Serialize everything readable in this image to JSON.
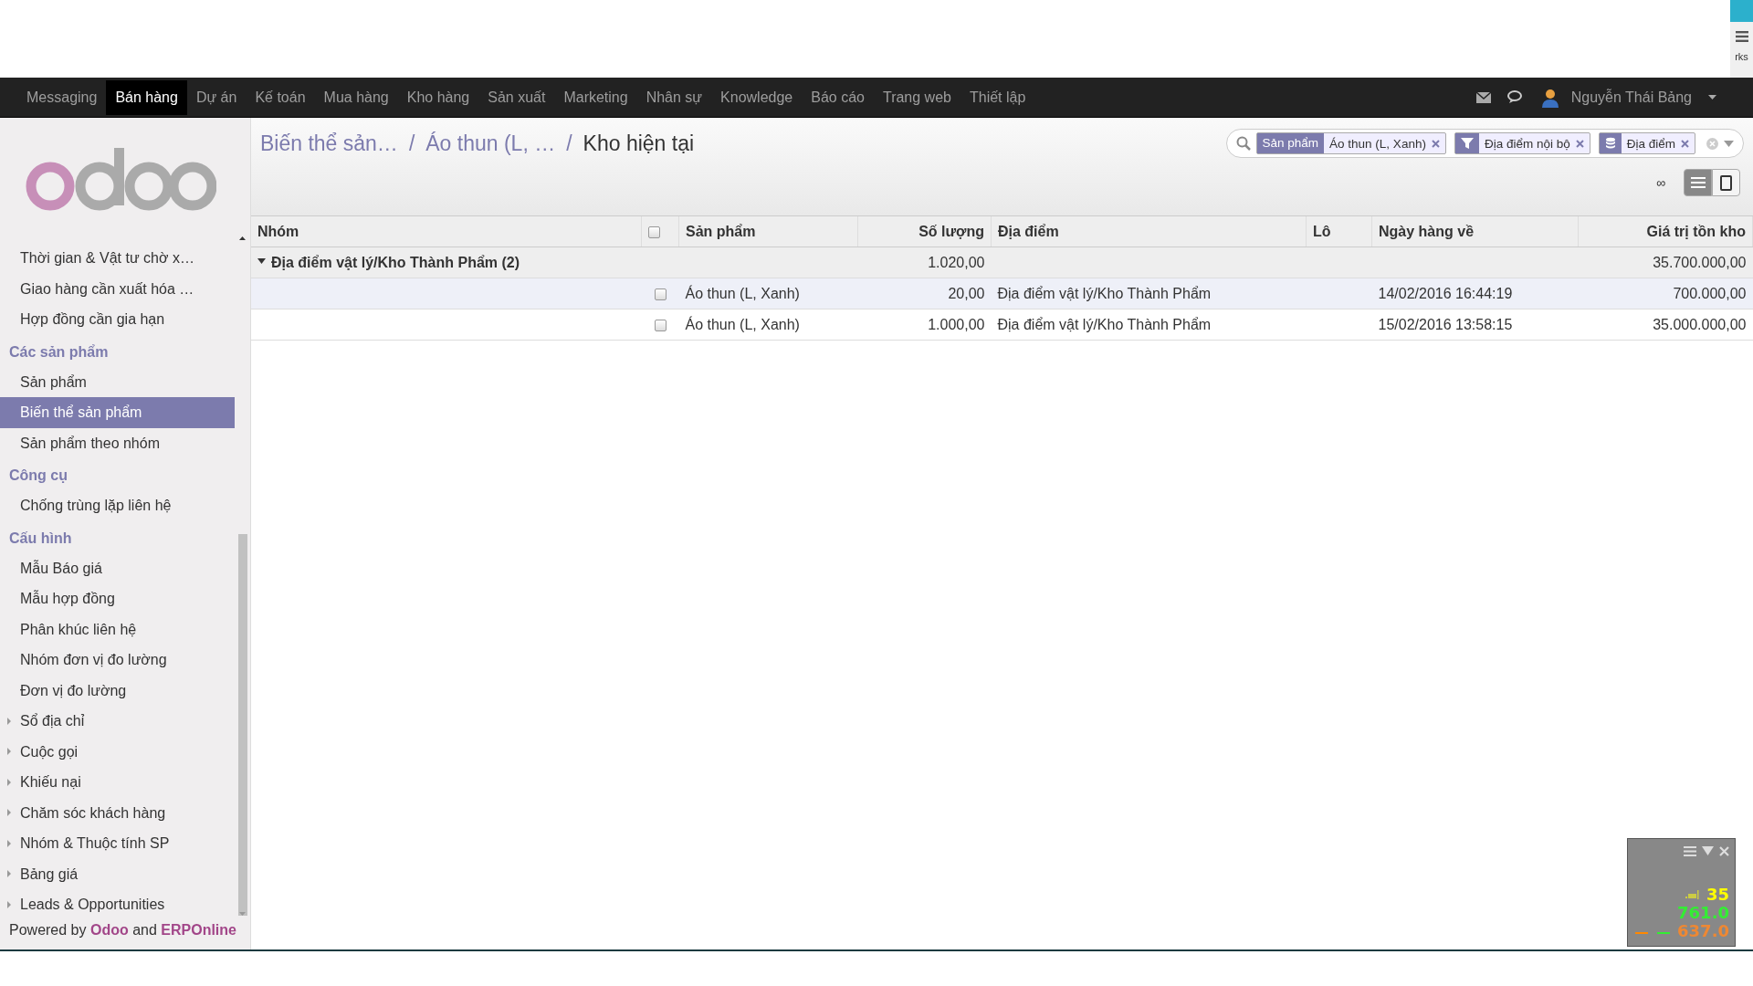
{
  "corner": {
    "text": "rks"
  },
  "navbar": {
    "apps": [
      {
        "label": "Messaging",
        "selected": false
      },
      {
        "label": "Bán hàng",
        "selected": true
      },
      {
        "label": "Dự án",
        "selected": false
      },
      {
        "label": "Kế toán",
        "selected": false
      },
      {
        "label": "Mua hàng",
        "selected": false
      },
      {
        "label": "Kho hàng",
        "selected": false
      },
      {
        "label": "Sản xuất",
        "selected": false
      },
      {
        "label": "Marketing",
        "selected": false
      },
      {
        "label": "Nhân sự",
        "selected": false
      },
      {
        "label": "Knowledge",
        "selected": false
      },
      {
        "label": "Báo cáo",
        "selected": false
      },
      {
        "label": "Trang web",
        "selected": false
      },
      {
        "label": "Thiết lập",
        "selected": false
      }
    ],
    "user": "Nguyễn Thái Bảng"
  },
  "sidebar": {
    "sections": [
      {
        "items": [
          {
            "label": "Thời gian & Vật tư chờ x…",
            "kind": "leaf",
            "selected": false
          },
          {
            "label": "Giao hàng cần xuất hóa …",
            "kind": "leaf",
            "selected": false
          },
          {
            "label": "Hợp đồng cần gia hạn",
            "kind": "leaf",
            "selected": false
          }
        ]
      },
      {
        "title": "Các sản phẩm",
        "items": [
          {
            "label": "Sản phẩm",
            "kind": "leaf",
            "selected": false
          },
          {
            "label": "Biến thể sản phẩm",
            "kind": "leaf",
            "selected": true
          },
          {
            "label": "Sản phẩm theo nhóm",
            "kind": "leaf",
            "selected": false
          }
        ]
      },
      {
        "title": "Công cụ",
        "items": [
          {
            "label": "Chống trùng lặp liên hệ",
            "kind": "leaf",
            "selected": false
          }
        ]
      },
      {
        "title": "Cấu hình",
        "items": [
          {
            "label": "Mẫu Báo giá",
            "kind": "leaf",
            "selected": false
          },
          {
            "label": "Mẫu hợp đồng",
            "kind": "leaf",
            "selected": false
          },
          {
            "label": "Phân khúc liên hệ",
            "kind": "leaf",
            "selected": false
          },
          {
            "label": "Nhóm đơn vị đo lường",
            "kind": "leaf",
            "selected": false
          },
          {
            "label": "Đơn vị đo lường",
            "kind": "leaf",
            "selected": false
          },
          {
            "label": "Sổ địa chỉ",
            "kind": "folder",
            "selected": false
          },
          {
            "label": "Cuộc gọi",
            "kind": "folder",
            "selected": false
          },
          {
            "label": "Khiếu nại",
            "kind": "folder",
            "selected": false
          },
          {
            "label": "Chăm sóc khách hàng",
            "kind": "folder",
            "selected": false
          },
          {
            "label": "Nhóm & Thuộc tính SP",
            "kind": "folder",
            "selected": false
          },
          {
            "label": "Bảng giá",
            "kind": "folder",
            "selected": false
          },
          {
            "label": "Leads & Opportunities",
            "kind": "folder",
            "selected": false
          }
        ]
      }
    ],
    "footer": "Powered by **Odoo** and **ERPOnline**"
  },
  "breadcrumb_separator": "/",
  "breadcrumb": [
    {
      "label": "Biến thể sản…",
      "current": false
    },
    {
      "label": "Áo thun (L, …",
      "current": false
    },
    {
      "label": "Kho hiện tại",
      "current": true
    }
  ],
  "search": {
    "facets": [
      {
        "kind": "field",
        "label": "Sản phẩm",
        "value": "Áo thun (L, Xanh)"
      },
      {
        "kind": "filter",
        "value": "Địa điểm nội bộ"
      },
      {
        "kind": "group",
        "value": "Địa điểm"
      }
    ]
  },
  "pager": "∞",
  "views": [
    {
      "kind": "list",
      "selected": true
    },
    {
      "kind": "form",
      "selected": false
    }
  ],
  "table": {
    "select_all_checked": false,
    "columns": [
      "Nhóm",
      "Sản phẩm",
      "Số lượng",
      "Địa điểm",
      "Lô",
      "Ngày hàng về",
      "Giá trị tồn kho"
    ],
    "groups": [
      {
        "label": "Địa điểm vật lý/Kho Thành Phẩm (2)",
        "expanded": true,
        "quantity": "1.020,00",
        "value": "35.700.000,00",
        "rows": [
          {
            "product": "Áo thun (L, Xanh)",
            "quantity": "20,00",
            "location": "Địa điểm vật lý/Kho Thành Phẩm",
            "date": "14/02/2016 16:44:19",
            "value": "700.000,00",
            "checked": false,
            "hover": true
          },
          {
            "product": "Áo thun (L, Xanh)",
            "quantity": "1.000,00",
            "location": "Địa điểm vật lý/Kho Thành Phẩm",
            "date": "15/02/2016 13:58:15",
            "value": "35.000.000,00",
            "checked": false,
            "hover": false
          }
        ]
      }
    ]
  },
  "monitor": {
    "readings": [
      {
        "text": "35",
        "color": "#ffff00"
      },
      {
        "text": "761.0",
        "color": "#33ee33"
      },
      {
        "text": "637.0",
        "color": "#ee8833"
      }
    ]
  }
}
